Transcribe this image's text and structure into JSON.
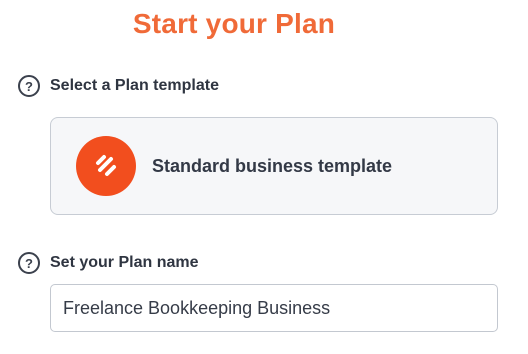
{
  "page": {
    "title": "Start your Plan"
  },
  "template_section": {
    "label": "Select a Plan template",
    "help_icon": "?",
    "selected_template": {
      "name": "Standard business template",
      "icon": "brand-logo-icon"
    }
  },
  "name_section": {
    "label": "Set your Plan name",
    "help_icon": "?",
    "plan_name_value": "Freelance Bookkeeping Business"
  },
  "colors": {
    "accent": "#f06a38",
    "logo_bg": "#f24e1e",
    "card_bg": "#f6f7f9",
    "border": "#c7ccd4"
  }
}
